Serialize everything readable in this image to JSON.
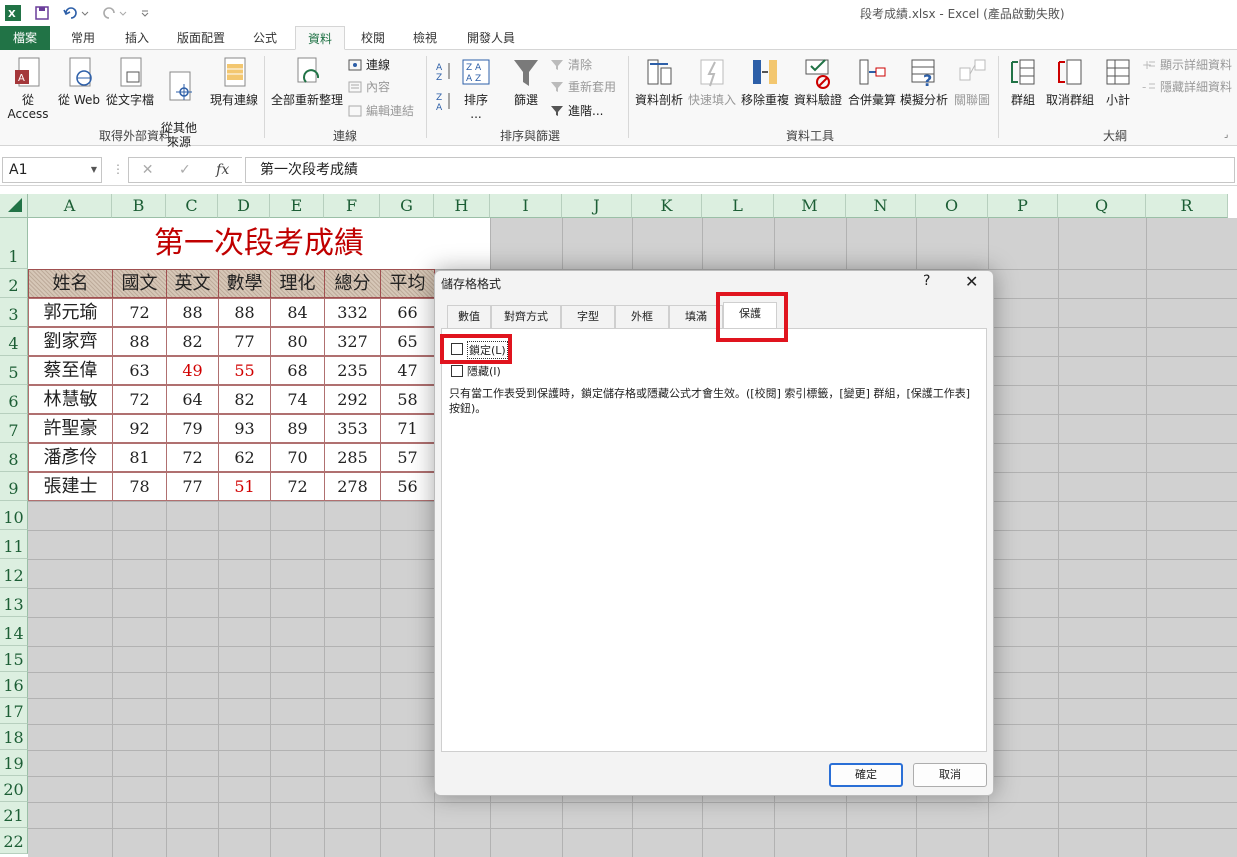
{
  "window": {
    "title": "段考成績.xlsx - Excel (產品啟動失敗)"
  },
  "ribbon_tabs": [
    "檔案",
    "常用",
    "插入",
    "版面配置",
    "公式",
    "資料",
    "校閱",
    "檢視",
    "開發人員"
  ],
  "ribbon": {
    "get_external": {
      "from_access": "從 Access",
      "from_web": "從 Web",
      "from_text": "從文字檔",
      "from_other": "從其他\n來源",
      "existing": "現有連線",
      "label": "取得外部資料"
    },
    "connections": {
      "refresh_all": "全部重新整理",
      "conn": "連線",
      "props": "內容",
      "edit_links": "編輯連結",
      "label": "連線"
    },
    "sort_filter": {
      "sort": "排序",
      "sort_sub": "...",
      "filter": "篩選",
      "clear": "清除",
      "reapply": "重新套用",
      "advanced": "進階...",
      "label": "排序與篩選"
    },
    "data_tools": {
      "text_to_col": "資料剖析",
      "flash_fill": "快速填入",
      "remove_dup": "移除重複",
      "validation": "資料驗證",
      "consolidate": "合併彙算",
      "what_if": "模擬分析",
      "relations": "關聯圖",
      "label": "資料工具"
    },
    "outline": {
      "group": "群組",
      "ungroup": "取消群組",
      "subtotal": "小計",
      "show_detail": "顯示詳細資料",
      "hide_detail": "隱藏詳細資料",
      "label": "大綱"
    }
  },
  "formula_bar": {
    "name_box": "A1",
    "fx": "fx",
    "formula": "第一次段考成績"
  },
  "columns": [
    "A",
    "B",
    "C",
    "D",
    "E",
    "F",
    "G",
    "H",
    "I",
    "J",
    "K",
    "L",
    "M",
    "N",
    "O",
    "P",
    "Q",
    "R"
  ],
  "rows": [
    "1",
    "2",
    "3",
    "4",
    "5",
    "6",
    "7",
    "8",
    "9",
    "10",
    "11",
    "12",
    "13",
    "14",
    "15",
    "16",
    "17",
    "18",
    "19",
    "20",
    "21",
    "22"
  ],
  "sheet": {
    "title": "第一次段考成績",
    "headers": [
      "姓名",
      "國文",
      "英文",
      "數學",
      "理化",
      "總分",
      "平均"
    ],
    "data": [
      [
        "郭元瑜",
        "72",
        "88",
        "88",
        "84",
        "332",
        "66"
      ],
      [
        "劉家齊",
        "88",
        "82",
        "77",
        "80",
        "327",
        "65"
      ],
      [
        "蔡至偉",
        "63",
        "49",
        "55",
        "68",
        "235",
        "47"
      ],
      [
        "林慧敏",
        "72",
        "64",
        "82",
        "74",
        "292",
        "58"
      ],
      [
        "許聖豪",
        "92",
        "79",
        "93",
        "89",
        "353",
        "71"
      ],
      [
        "潘彥伶",
        "81",
        "72",
        "62",
        "70",
        "285",
        "57"
      ],
      [
        "張建士",
        "78",
        "77",
        "51",
        "72",
        "278",
        "56"
      ]
    ]
  },
  "dialog": {
    "title": "儲存格格式",
    "help": "?",
    "close": "✕",
    "tabs": [
      "數值",
      "對齊方式",
      "字型",
      "外框",
      "填滿",
      "保護"
    ],
    "locked_label": "鎖定(L)",
    "hidden_label": "隱藏(I)",
    "description": "只有當工作表受到保護時，鎖定儲存格或隱藏公式才會生效。([校閱] 索引標籤，[變更] 群組，[保護工作表] 按鈕)。",
    "ok": "確定",
    "cancel": "取消"
  },
  "colors": {
    "excel_green": "#217346",
    "sheet_title": "#c00000",
    "highlight": "#e0141e"
  }
}
